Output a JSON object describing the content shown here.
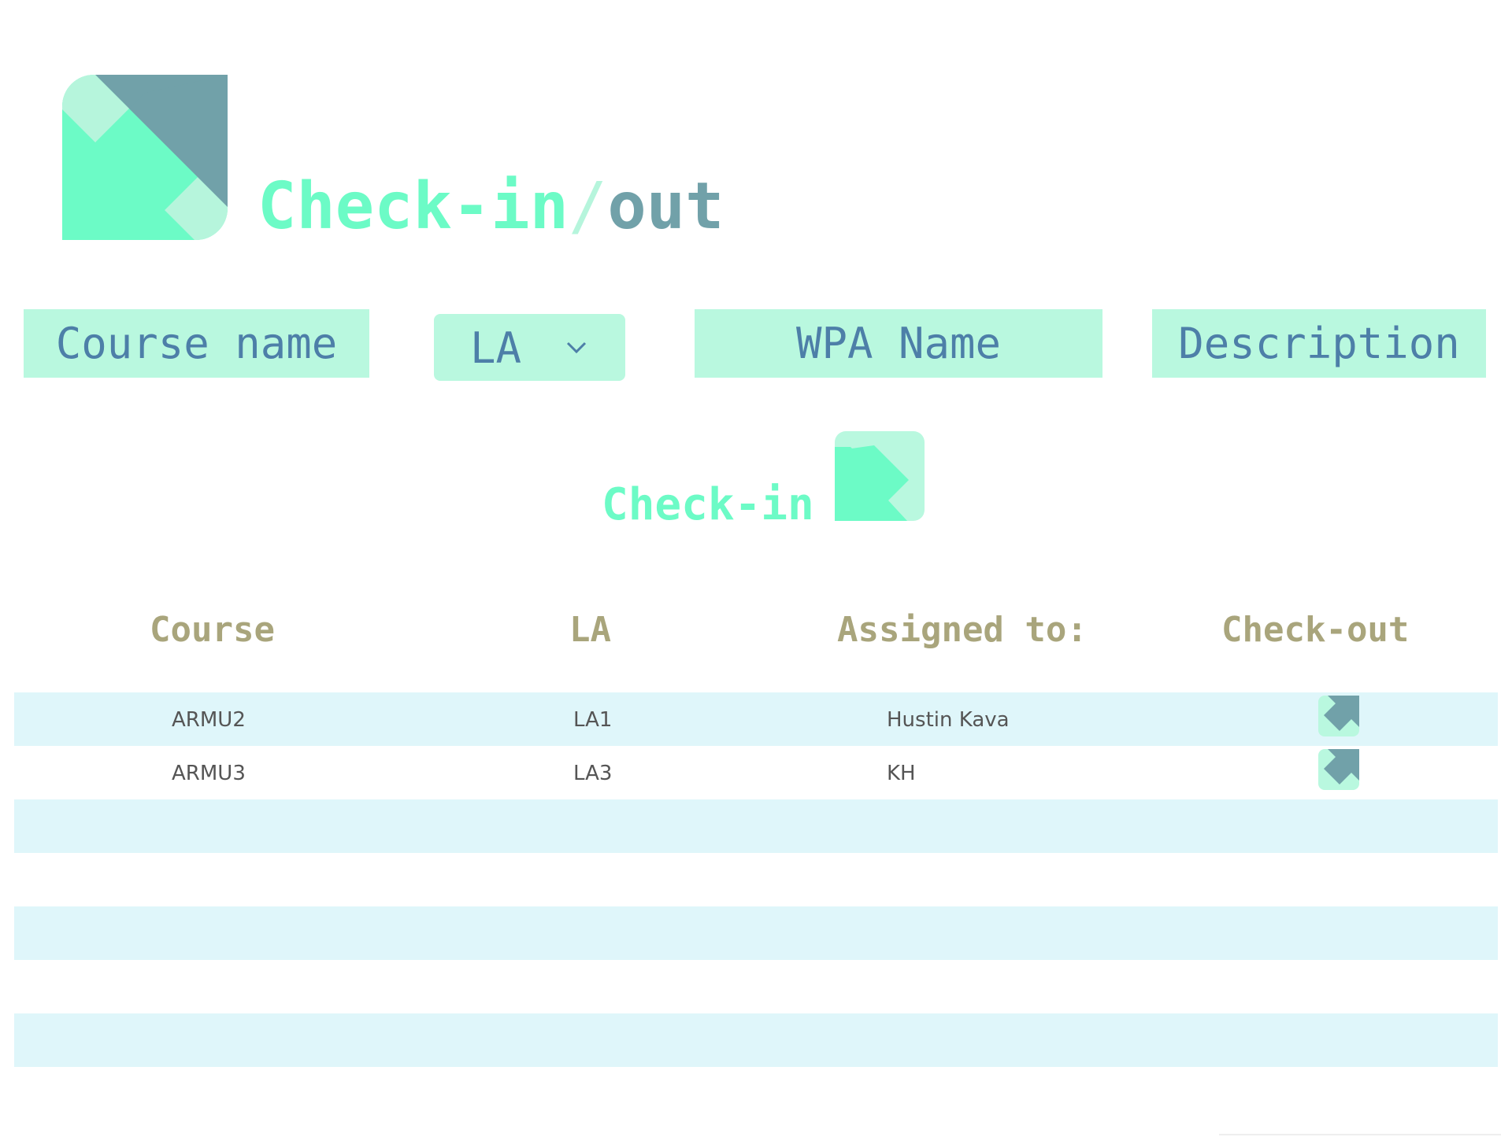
{
  "header": {
    "title_part1": "Check-in",
    "title_sep": "/",
    "title_part2": "out",
    "logo_icon": "check-in-out-arrow-icon"
  },
  "form": {
    "course_name": "Course name",
    "la_select": "LA",
    "wpa_name": "WPA Name",
    "description": "Description"
  },
  "checkin_button": {
    "label": "Check-in",
    "icon": "check-in-arrow-icon"
  },
  "table": {
    "headers": [
      "Course",
      "LA",
      "Assigned to:",
      "Check-out"
    ],
    "rows": [
      {
        "course": "ARMU2",
        "la": "LA1",
        "assigned_to": "Hustin Kava",
        "action_icon": "check-out-arrow-icon"
      },
      {
        "course": "ARMU3",
        "la": "LA3",
        "assigned_to": "KH",
        "action_icon": "check-out-arrow-icon"
      }
    ],
    "empty_rows": 5
  },
  "colors": {
    "accent_green": "#6cfbc6",
    "light_green": "#b9f8df",
    "slate": "#71a1a9",
    "field_text": "#4d7fa8",
    "header_text": "#a9a57c",
    "row_alt": "#dff6fa"
  }
}
